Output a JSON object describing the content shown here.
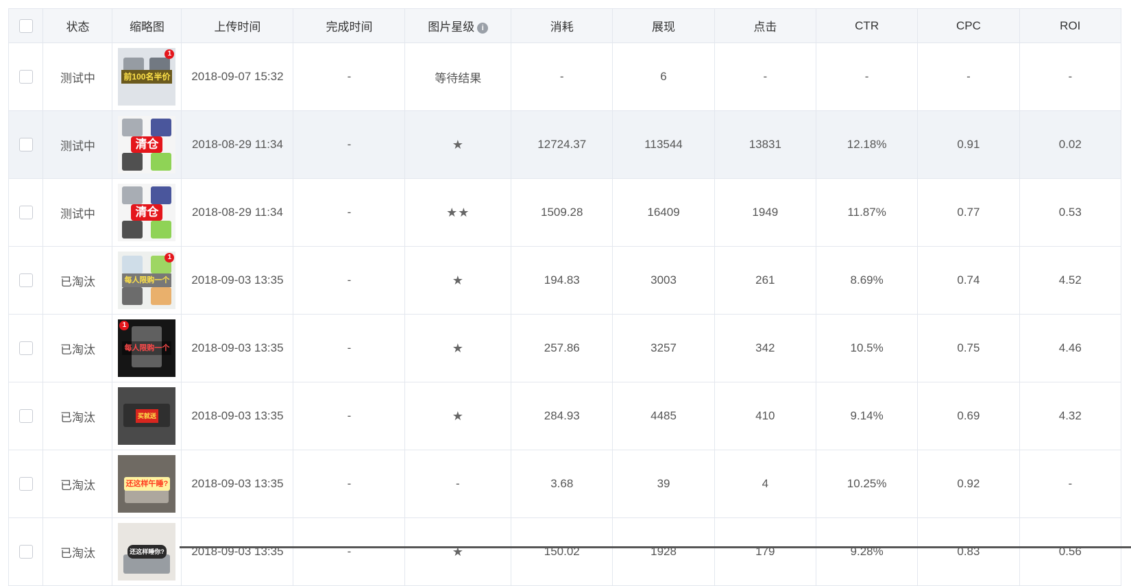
{
  "table": {
    "headers": {
      "status": "状态",
      "thumbnail": "缩略图",
      "upload_time": "上传时间",
      "finish_time": "完成时间",
      "star_level": "图片星级",
      "spend": "消耗",
      "impressions": "展现",
      "clicks": "点击",
      "ctr": "CTR",
      "cpc": "CPC",
      "roi": "ROI"
    },
    "info_icon": "i",
    "rows": [
      {
        "status": "测试中",
        "thumb_caption": "前100名半价",
        "thumb_badge": "1",
        "upload_time": "2018-09-07 15:32",
        "finish_time": "-",
        "stars": "等待结果",
        "spend": "-",
        "impressions": "6",
        "clicks": "-",
        "ctr": "-",
        "cpc": "-",
        "roi": "-"
      },
      {
        "status": "测试中",
        "thumb_caption": "清仓",
        "thumb_badge": "",
        "upload_time": "2018-08-29 11:34",
        "finish_time": "-",
        "stars": "★",
        "spend": "12724.37",
        "impressions": "113544",
        "clicks": "13831",
        "ctr": "12.18%",
        "cpc": "0.91",
        "roi": "0.02"
      },
      {
        "status": "测试中",
        "thumb_caption": "清仓",
        "thumb_badge": "",
        "upload_time": "2018-08-29 11:34",
        "finish_time": "-",
        "stars": "★★",
        "spend": "1509.28",
        "impressions": "16409",
        "clicks": "1949",
        "ctr": "11.87%",
        "cpc": "0.77",
        "roi": "0.53"
      },
      {
        "status": "已淘汰",
        "thumb_caption": "每人限购一个",
        "thumb_badge": "1",
        "upload_time": "2018-09-03 13:35",
        "finish_time": "-",
        "stars": "★",
        "spend": "194.83",
        "impressions": "3003",
        "clicks": "261",
        "ctr": "8.69%",
        "cpc": "0.74",
        "roi": "4.52"
      },
      {
        "status": "已淘汰",
        "thumb_caption": "每人限购一个",
        "thumb_badge": "1",
        "upload_time": "2018-09-03 13:35",
        "finish_time": "-",
        "stars": "★",
        "spend": "257.86",
        "impressions": "3257",
        "clicks": "342",
        "ctr": "10.5%",
        "cpc": "0.75",
        "roi": "4.46"
      },
      {
        "status": "已淘汰",
        "thumb_caption": "买就送",
        "thumb_badge": "",
        "upload_time": "2018-09-03 13:35",
        "finish_time": "-",
        "stars": "★",
        "spend": "284.93",
        "impressions": "4485",
        "clicks": "410",
        "ctr": "9.14%",
        "cpc": "0.69",
        "roi": "4.32"
      },
      {
        "status": "已淘汰",
        "thumb_caption": "还这样午睡?",
        "thumb_badge": "",
        "upload_time": "2018-09-03 13:35",
        "finish_time": "-",
        "stars": "-",
        "spend": "3.68",
        "impressions": "39",
        "clicks": "4",
        "ctr": "10.25%",
        "cpc": "0.92",
        "roi": "-"
      },
      {
        "status": "已淘汰",
        "thumb_caption": "还这样睡你?",
        "thumb_badge": "",
        "upload_time": "2018-09-03 13:35",
        "finish_time": "-",
        "stars": "★",
        "spend": "150.02",
        "impressions": "1928",
        "clicks": "179",
        "ctr": "9.28%",
        "cpc": "0.83",
        "roi": "0.56"
      }
    ]
  }
}
